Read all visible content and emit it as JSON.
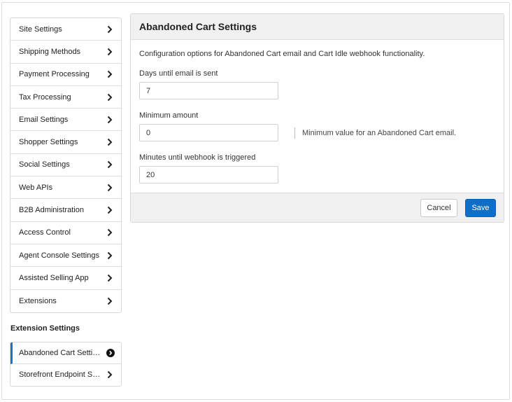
{
  "sidebar": {
    "items": [
      {
        "label": "Site Settings"
      },
      {
        "label": "Shipping Methods"
      },
      {
        "label": "Payment Processing"
      },
      {
        "label": "Tax Processing"
      },
      {
        "label": "Email Settings"
      },
      {
        "label": "Shopper Settings"
      },
      {
        "label": "Social Settings"
      },
      {
        "label": "Web APIs"
      },
      {
        "label": "B2B Administration"
      },
      {
        "label": "Access Control"
      },
      {
        "label": "Agent Console Settings"
      },
      {
        "label": "Assisted Selling App"
      },
      {
        "label": "Extensions"
      }
    ],
    "section_title": "Extension Settings",
    "extension_items": [
      {
        "label": "Abandoned Cart Settings",
        "active": true
      },
      {
        "label": "Storefront Endpoint Settings",
        "active": false
      }
    ]
  },
  "panel": {
    "title": "Abandoned Cart Settings",
    "description": "Configuration options for Abandoned Cart email and Cart Idle webhook functionality.",
    "fields": [
      {
        "label": "Days until email is sent",
        "value": "7",
        "hint": ""
      },
      {
        "label": "Minimum amount",
        "value": "0",
        "hint": "Minimum value for an Abandoned Cart email."
      },
      {
        "label": "Minutes until webhook is triggered",
        "value": "20",
        "hint": ""
      }
    ],
    "cancel_label": "Cancel",
    "save_label": "Save"
  },
  "colors": {
    "accent": "#0f6fc6",
    "active_border": "#1a73c9",
    "header_bg": "#f0f0f0"
  },
  "icons": {
    "menu_chevron": "chevron-right-icon",
    "active_indicator": "circle-chevron-right-icon"
  }
}
